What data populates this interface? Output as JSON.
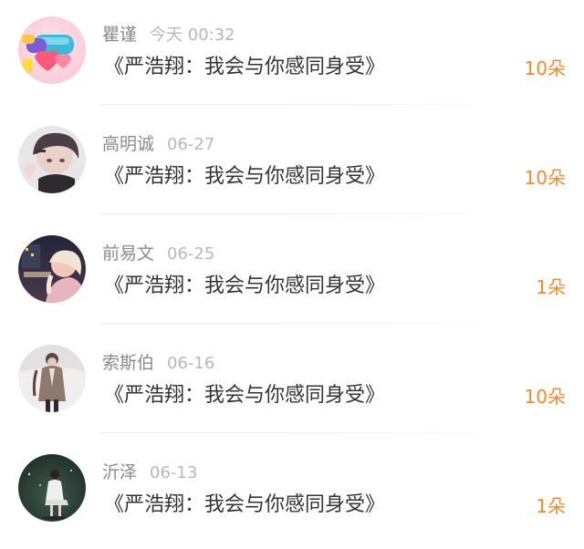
{
  "gift_list": {
    "items": [
      {
        "avatar": "avatar-pink-3d-icons",
        "name": "瞿谨",
        "time": "今天 00:32",
        "title": "《严浩翔：我会与你感同身受》",
        "count": "10朵"
      },
      {
        "avatar": "avatar-boy-portrait",
        "name": "高明诚",
        "time": "06-27",
        "title": "《严浩翔：我会与你感同身受》",
        "count": "10朵"
      },
      {
        "avatar": "avatar-girl-night-city",
        "name": "前易文",
        "time": "06-25",
        "title": "《严浩翔：我会与你感同身受》",
        "count": "1朵"
      },
      {
        "avatar": "avatar-person-long-coat",
        "name": "索斯伯",
        "time": "06-16",
        "title": "《严浩翔：我会与你感同身受》",
        "count": "10朵"
      },
      {
        "avatar": "avatar-girl-dark-field",
        "name": "沂泽",
        "time": "06-13",
        "title": "《严浩翔：我会与你感同身受》",
        "count": "1朵"
      }
    ]
  },
  "colors": {
    "accent_count": "#f08c2c",
    "name_gray": "#8a8a8a",
    "time_gray": "#b8b8b8",
    "title_dark": "#333333"
  }
}
